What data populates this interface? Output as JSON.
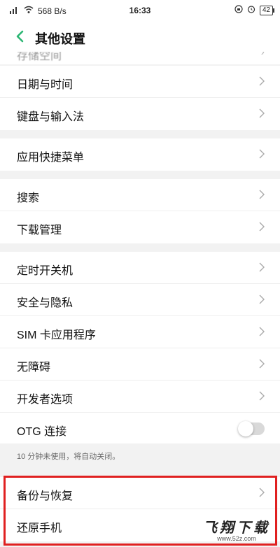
{
  "status_bar": {
    "network_speed": "568 B/s",
    "time": "16:33",
    "battery": "42"
  },
  "header": {
    "title": "其他设置"
  },
  "partial_row": {
    "label": "存储空间"
  },
  "groups": [
    {
      "items": [
        "日期与时间",
        "键盘与输入法"
      ]
    },
    {
      "items": [
        "应用快捷菜单"
      ]
    },
    {
      "items": [
        "搜索",
        "下载管理"
      ]
    },
    {
      "items": [
        "定时开关机",
        "安全与隐私",
        "SIM 卡应用程序",
        "无障碍",
        "开发者选项",
        "OTG 连接"
      ]
    },
    {
      "items": [
        "备份与恢复",
        "还原手机"
      ]
    }
  ],
  "otg": {
    "enabled": false
  },
  "otg_note": "10 分钟未使用，将自动关闭。",
  "watermark": {
    "main": "飞翔下载",
    "sub": "www.52z.com"
  },
  "colors": {
    "accent_back": "#2bb673",
    "highlight_border": "#e02020",
    "toggle_off": "#d9d9d9"
  }
}
